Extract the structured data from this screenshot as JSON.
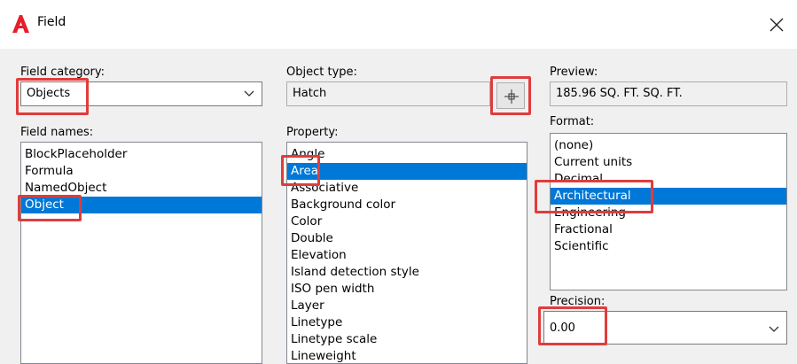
{
  "window": {
    "title": "Field"
  },
  "field_category": {
    "label": "Field category:",
    "value": "Objects"
  },
  "field_names": {
    "label": "Field names:",
    "items": [
      "BlockPlaceholder",
      "Formula",
      "NamedObject",
      "Object"
    ],
    "selected": 3
  },
  "object_type": {
    "label": "Object type:",
    "value": "Hatch"
  },
  "property": {
    "label": "Property:",
    "items": [
      "Angle",
      "Area",
      "Associative",
      "Background color",
      "Color",
      "Double",
      "Elevation",
      "Island detection style",
      "ISO pen width",
      "Layer",
      "Linetype",
      "Linetype scale",
      "Lineweight"
    ],
    "selected": 1
  },
  "preview": {
    "label": "Preview:",
    "value": "185.96 SQ. FT. SQ. FT."
  },
  "format": {
    "label": "Format:",
    "items": [
      "(none)",
      "Current units",
      "Decimal",
      "Architectural",
      "Engineering",
      "Fractional",
      "Scientific"
    ],
    "selected": 3
  },
  "precision": {
    "label": "Precision:",
    "value": "0.00"
  },
  "colors": {
    "selection": "#0078d7",
    "highlight": "#e03c3c",
    "logo": "#e3202a"
  }
}
